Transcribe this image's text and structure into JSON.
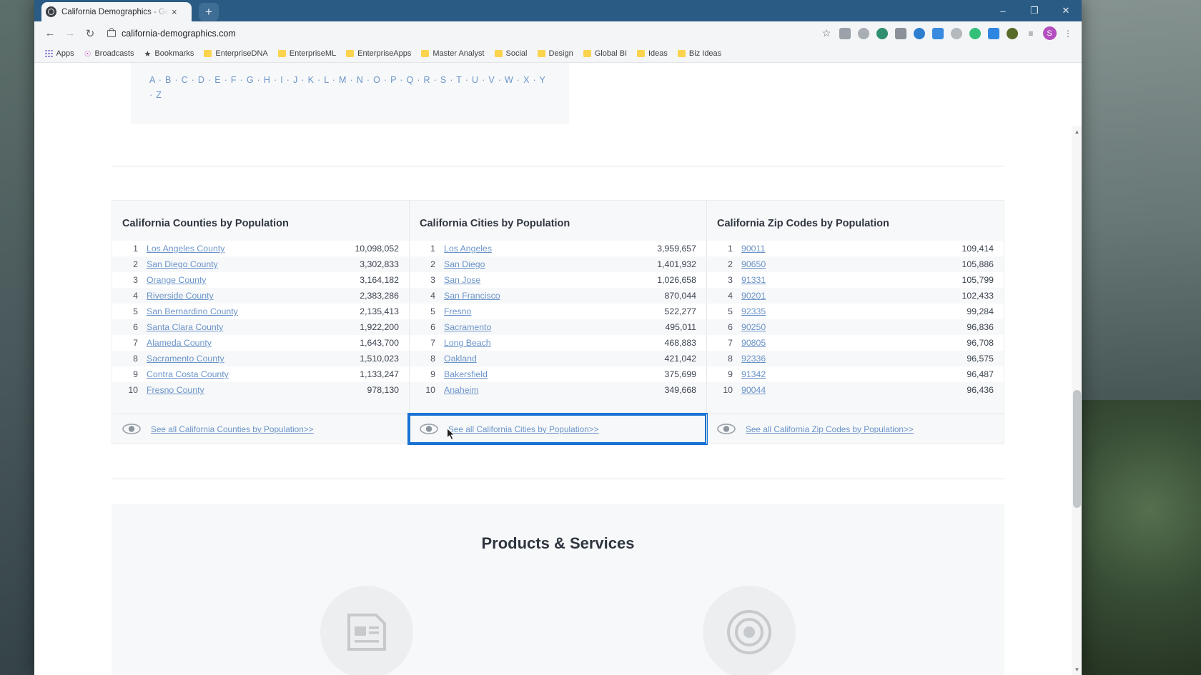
{
  "browser": {
    "tab": {
      "title": "California Demographics - Get C",
      "favicon": "globe-icon",
      "close": "×"
    },
    "new_tab": "+",
    "window_controls": {
      "minimize": "–",
      "maximize": "❐",
      "close": "✕"
    },
    "nav": {
      "back": "←",
      "forward": "→",
      "reload": "↻"
    },
    "omnibox": {
      "url": "california-demographics.com",
      "lock": "lock-icon"
    },
    "toolbar_icons": [
      {
        "name": "bookmark-star-icon",
        "glyph": "☆",
        "color": "#5f6368"
      },
      {
        "name": "extension-screenshot-icon",
        "color": "#8a9198"
      },
      {
        "name": "extension-skype-icon",
        "color": "#9aa1a8"
      },
      {
        "name": "extension-whatsapp-icon",
        "color": "#2f8f6e"
      },
      {
        "name": "extension-library-icon",
        "color": "#8a9198"
      },
      {
        "name": "extension-moon-icon",
        "color": "#2f7fd0"
      },
      {
        "name": "extension-window-icon",
        "color": "#3a8ae0"
      },
      {
        "name": "extension-gray-circle-icon",
        "color": "#aab0b5"
      },
      {
        "name": "extension-refresh-green-icon",
        "color": "#35c07a"
      },
      {
        "name": "extension-key-icon",
        "color": "#2f86e0"
      },
      {
        "name": "extension-olive-icon",
        "color": "#586b2a"
      }
    ],
    "menu_icons": {
      "reading_list": "≡",
      "profile_initial": "S",
      "overflow": "⋮"
    },
    "bookmarks": [
      {
        "label": "Apps",
        "icon": "apps-grid-icon"
      },
      {
        "label": "Broadcasts",
        "icon": "broadcast-icon"
      },
      {
        "label": "Bookmarks",
        "icon": "star-icon"
      },
      {
        "label": "EnterpriseDNA",
        "icon": "folder-icon"
      },
      {
        "label": "EnterpriseML",
        "icon": "folder-icon"
      },
      {
        "label": "EnterpriseApps",
        "icon": "folder-icon"
      },
      {
        "label": "Master Analyst",
        "icon": "folder-icon"
      },
      {
        "label": "Social",
        "icon": "folder-icon"
      },
      {
        "label": "Design",
        "icon": "folder-icon"
      },
      {
        "label": "Global BI",
        "icon": "folder-icon"
      },
      {
        "label": "Ideas",
        "icon": "folder-icon"
      },
      {
        "label": "Biz Ideas",
        "icon": "folder-icon"
      }
    ]
  },
  "page": {
    "alphabet": "A · B · C · D · E · F · G · H · I · J · K · L · M · N · O · P · Q · R · S · T · U · V · W · X · Y · Z",
    "columns": [
      {
        "title": "California Counties by Population",
        "footer_link": "See all California Counties by Population>>",
        "rows": [
          {
            "rank": "1",
            "name": "Los Angeles County",
            "value": "10,098,052"
          },
          {
            "rank": "2",
            "name": "San Diego County",
            "value": "3,302,833"
          },
          {
            "rank": "3",
            "name": "Orange County",
            "value": "3,164,182"
          },
          {
            "rank": "4",
            "name": "Riverside County",
            "value": "2,383,286"
          },
          {
            "rank": "5",
            "name": "San Bernardino County",
            "value": "2,135,413"
          },
          {
            "rank": "6",
            "name": "Santa Clara County",
            "value": "1,922,200"
          },
          {
            "rank": "7",
            "name": "Alameda County",
            "value": "1,643,700"
          },
          {
            "rank": "8",
            "name": "Sacramento County",
            "value": "1,510,023"
          },
          {
            "rank": "9",
            "name": "Contra Costa County",
            "value": "1,133,247"
          },
          {
            "rank": "10",
            "name": "Fresno County",
            "value": "978,130"
          }
        ]
      },
      {
        "title": "California Cities by Population",
        "footer_link": "See all California Cities by Population>>",
        "focused": true,
        "rows": [
          {
            "rank": "1",
            "name": "Los Angeles",
            "value": "3,959,657"
          },
          {
            "rank": "2",
            "name": "San Diego",
            "value": "1,401,932"
          },
          {
            "rank": "3",
            "name": "San Jose",
            "value": "1,026,658"
          },
          {
            "rank": "4",
            "name": "San Francisco",
            "value": "870,044"
          },
          {
            "rank": "5",
            "name": "Fresno",
            "value": "522,277"
          },
          {
            "rank": "6",
            "name": "Sacramento",
            "value": "495,011"
          },
          {
            "rank": "7",
            "name": "Long Beach",
            "value": "468,883"
          },
          {
            "rank": "8",
            "name": "Oakland",
            "value": "421,042"
          },
          {
            "rank": "9",
            "name": "Bakersfield",
            "value": "375,699"
          },
          {
            "rank": "10",
            "name": "Anaheim",
            "value": "349,668"
          }
        ]
      },
      {
        "title": "California Zip Codes by Population",
        "footer_link": "See all California Zip Codes by Population>>",
        "rows": [
          {
            "rank": "1",
            "name": "90011",
            "value": "109,414"
          },
          {
            "rank": "2",
            "name": "90650",
            "value": "105,886"
          },
          {
            "rank": "3",
            "name": "91331",
            "value": "105,799"
          },
          {
            "rank": "4",
            "name": "90201",
            "value": "102,433"
          },
          {
            "rank": "5",
            "name": "92335",
            "value": "99,284"
          },
          {
            "rank": "6",
            "name": "90250",
            "value": "96,836"
          },
          {
            "rank": "7",
            "name": "90805",
            "value": "96,708"
          },
          {
            "rank": "8",
            "name": "92336",
            "value": "96,575"
          },
          {
            "rank": "9",
            "name": "91342",
            "value": "96,487"
          },
          {
            "rank": "10",
            "name": "90044",
            "value": "96,436"
          }
        ]
      }
    ],
    "products_title": "Products & Services",
    "accent_color": "#6b94c9",
    "focus_color": "#1a73d4"
  }
}
